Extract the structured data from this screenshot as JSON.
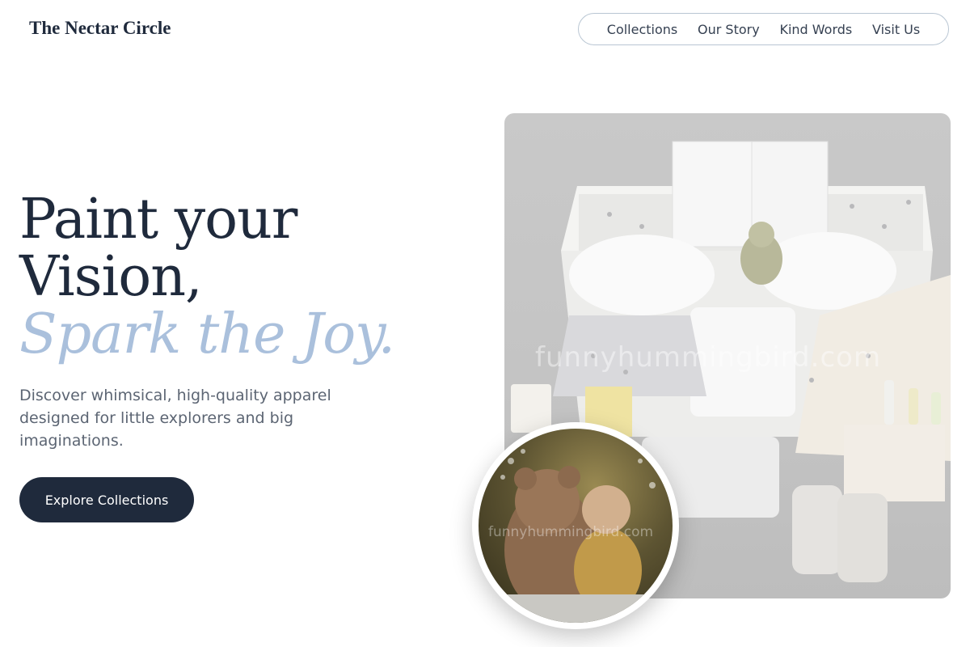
{
  "header": {
    "brand": "The Nectar Circle",
    "nav": [
      "Collections",
      "Our Story",
      "Kind Words",
      "Visit Us"
    ]
  },
  "hero": {
    "title_line1": "Paint your",
    "title_line2": "Vision,",
    "title_accent": "Spark the Joy.",
    "subtitle": "Discover whimsical, high-quality apparel designed for little explorers and big imaginations.",
    "cta_label": "Explore Collections"
  },
  "images": {
    "main_watermark": "funnyhummingbird.com",
    "circle_watermark": "funnyhummingbird.com"
  },
  "colors": {
    "primary": "#1f2a3c",
    "accent": "#aac0dc",
    "muted_text": "#5c6573",
    "nav_border": "#b9c6d3"
  }
}
